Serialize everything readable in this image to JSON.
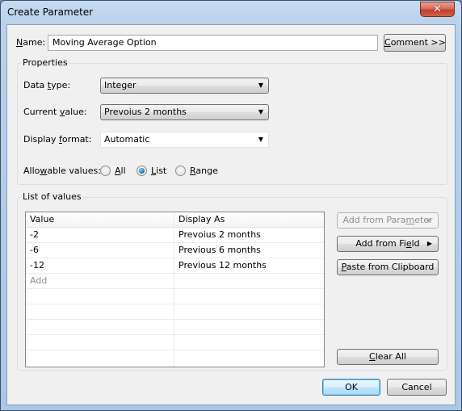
{
  "window": {
    "title": "Create Parameter",
    "close_icon": "close-x"
  },
  "name_field": {
    "label_mnemonic": "N",
    "label_rest": "ame:",
    "value": "Moving Average Option"
  },
  "comment_button": {
    "mnemonic": "C",
    "rest": "omment >>"
  },
  "properties": {
    "group_title": "Properties",
    "data_type": {
      "label_pre": "Data ",
      "label_mnemonic": "t",
      "label_post": "ype:",
      "value": "Integer"
    },
    "current_value": {
      "label_pre": "Current ",
      "label_mnemonic": "v",
      "label_post": "alue:",
      "value": "Prevoius 2 months"
    },
    "display_format": {
      "label_pre": "Display ",
      "label_mnemonic": "f",
      "label_post": "ormat:",
      "value": "Automatic"
    },
    "allowable_values": {
      "label_pre": "Allo",
      "label_mnemonic": "w",
      "label_post": "able values:",
      "options": [
        {
          "mnemonic": "A",
          "rest": "ll",
          "checked": false
        },
        {
          "mnemonic": "L",
          "rest": "ist",
          "checked": true
        },
        {
          "mnemonic": "R",
          "rest": "ange",
          "checked": false
        }
      ],
      "selected": "List"
    }
  },
  "list_of_values": {
    "group_title": "List of values",
    "columns": [
      "Value",
      "Display As"
    ],
    "rows": [
      {
        "value": "-2",
        "display_as": "Prevoius 2 months"
      },
      {
        "value": "-6",
        "display_as": "Previous 6 months"
      },
      {
        "value": "-12",
        "display_as": "Previous 12 months"
      }
    ],
    "add_placeholder": "Add",
    "buttons": {
      "add_from_parameter": {
        "pre": "Add from Para",
        "mnemonic": "m",
        "post": "eter",
        "enabled": false
      },
      "add_from_field": {
        "pre": "Add from Fi",
        "mnemonic": "e",
        "post": "ld",
        "enabled": true
      },
      "paste_from_clipboard": {
        "pre": "",
        "mnemonic": "P",
        "post": "aste from Clipboard",
        "enabled": true
      },
      "clear_all": {
        "pre": "",
        "mnemonic": "C",
        "post": "lear All",
        "enabled": true
      }
    }
  },
  "footer": {
    "ok": "OK",
    "cancel": "Cancel"
  },
  "icons": {
    "submenu_arrow": "▶",
    "dropdown_arrow": "▼"
  }
}
